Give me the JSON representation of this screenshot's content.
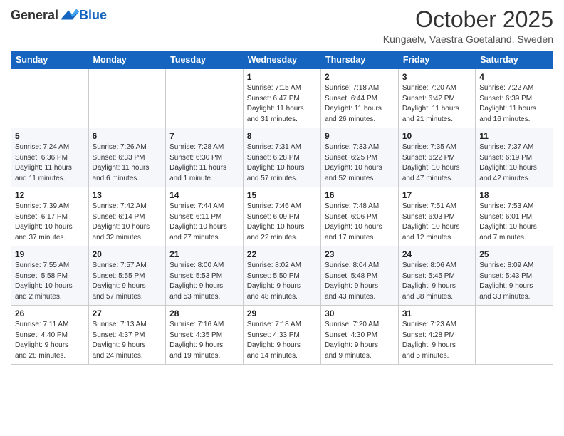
{
  "header": {
    "logo_general": "General",
    "logo_blue": "Blue",
    "month_title": "October 2025",
    "subtitle": "Kungaelv, Vaestra Goetaland, Sweden"
  },
  "days_of_week": [
    "Sunday",
    "Monday",
    "Tuesday",
    "Wednesday",
    "Thursday",
    "Friday",
    "Saturday"
  ],
  "weeks": [
    [
      {
        "day": "",
        "info": ""
      },
      {
        "day": "",
        "info": ""
      },
      {
        "day": "",
        "info": ""
      },
      {
        "day": "1",
        "info": "Sunrise: 7:15 AM\nSunset: 6:47 PM\nDaylight: 11 hours\nand 31 minutes."
      },
      {
        "day": "2",
        "info": "Sunrise: 7:18 AM\nSunset: 6:44 PM\nDaylight: 11 hours\nand 26 minutes."
      },
      {
        "day": "3",
        "info": "Sunrise: 7:20 AM\nSunset: 6:42 PM\nDaylight: 11 hours\nand 21 minutes."
      },
      {
        "day": "4",
        "info": "Sunrise: 7:22 AM\nSunset: 6:39 PM\nDaylight: 11 hours\nand 16 minutes."
      }
    ],
    [
      {
        "day": "5",
        "info": "Sunrise: 7:24 AM\nSunset: 6:36 PM\nDaylight: 11 hours\nand 11 minutes."
      },
      {
        "day": "6",
        "info": "Sunrise: 7:26 AM\nSunset: 6:33 PM\nDaylight: 11 hours\nand 6 minutes."
      },
      {
        "day": "7",
        "info": "Sunrise: 7:28 AM\nSunset: 6:30 PM\nDaylight: 11 hours\nand 1 minute."
      },
      {
        "day": "8",
        "info": "Sunrise: 7:31 AM\nSunset: 6:28 PM\nDaylight: 10 hours\nand 57 minutes."
      },
      {
        "day": "9",
        "info": "Sunrise: 7:33 AM\nSunset: 6:25 PM\nDaylight: 10 hours\nand 52 minutes."
      },
      {
        "day": "10",
        "info": "Sunrise: 7:35 AM\nSunset: 6:22 PM\nDaylight: 10 hours\nand 47 minutes."
      },
      {
        "day": "11",
        "info": "Sunrise: 7:37 AM\nSunset: 6:19 PM\nDaylight: 10 hours\nand 42 minutes."
      }
    ],
    [
      {
        "day": "12",
        "info": "Sunrise: 7:39 AM\nSunset: 6:17 PM\nDaylight: 10 hours\nand 37 minutes."
      },
      {
        "day": "13",
        "info": "Sunrise: 7:42 AM\nSunset: 6:14 PM\nDaylight: 10 hours\nand 32 minutes."
      },
      {
        "day": "14",
        "info": "Sunrise: 7:44 AM\nSunset: 6:11 PM\nDaylight: 10 hours\nand 27 minutes."
      },
      {
        "day": "15",
        "info": "Sunrise: 7:46 AM\nSunset: 6:09 PM\nDaylight: 10 hours\nand 22 minutes."
      },
      {
        "day": "16",
        "info": "Sunrise: 7:48 AM\nSunset: 6:06 PM\nDaylight: 10 hours\nand 17 minutes."
      },
      {
        "day": "17",
        "info": "Sunrise: 7:51 AM\nSunset: 6:03 PM\nDaylight: 10 hours\nand 12 minutes."
      },
      {
        "day": "18",
        "info": "Sunrise: 7:53 AM\nSunset: 6:01 PM\nDaylight: 10 hours\nand 7 minutes."
      }
    ],
    [
      {
        "day": "19",
        "info": "Sunrise: 7:55 AM\nSunset: 5:58 PM\nDaylight: 10 hours\nand 2 minutes."
      },
      {
        "day": "20",
        "info": "Sunrise: 7:57 AM\nSunset: 5:55 PM\nDaylight: 9 hours\nand 57 minutes."
      },
      {
        "day": "21",
        "info": "Sunrise: 8:00 AM\nSunset: 5:53 PM\nDaylight: 9 hours\nand 53 minutes."
      },
      {
        "day": "22",
        "info": "Sunrise: 8:02 AM\nSunset: 5:50 PM\nDaylight: 9 hours\nand 48 minutes."
      },
      {
        "day": "23",
        "info": "Sunrise: 8:04 AM\nSunset: 5:48 PM\nDaylight: 9 hours\nand 43 minutes."
      },
      {
        "day": "24",
        "info": "Sunrise: 8:06 AM\nSunset: 5:45 PM\nDaylight: 9 hours\nand 38 minutes."
      },
      {
        "day": "25",
        "info": "Sunrise: 8:09 AM\nSunset: 5:43 PM\nDaylight: 9 hours\nand 33 minutes."
      }
    ],
    [
      {
        "day": "26",
        "info": "Sunrise: 7:11 AM\nSunset: 4:40 PM\nDaylight: 9 hours\nand 28 minutes."
      },
      {
        "day": "27",
        "info": "Sunrise: 7:13 AM\nSunset: 4:37 PM\nDaylight: 9 hours\nand 24 minutes."
      },
      {
        "day": "28",
        "info": "Sunrise: 7:16 AM\nSunset: 4:35 PM\nDaylight: 9 hours\nand 19 minutes."
      },
      {
        "day": "29",
        "info": "Sunrise: 7:18 AM\nSunset: 4:33 PM\nDaylight: 9 hours\nand 14 minutes."
      },
      {
        "day": "30",
        "info": "Sunrise: 7:20 AM\nSunset: 4:30 PM\nDaylight: 9 hours\nand 9 minutes."
      },
      {
        "day": "31",
        "info": "Sunrise: 7:23 AM\nSunset: 4:28 PM\nDaylight: 9 hours\nand 5 minutes."
      },
      {
        "day": "",
        "info": ""
      }
    ]
  ]
}
